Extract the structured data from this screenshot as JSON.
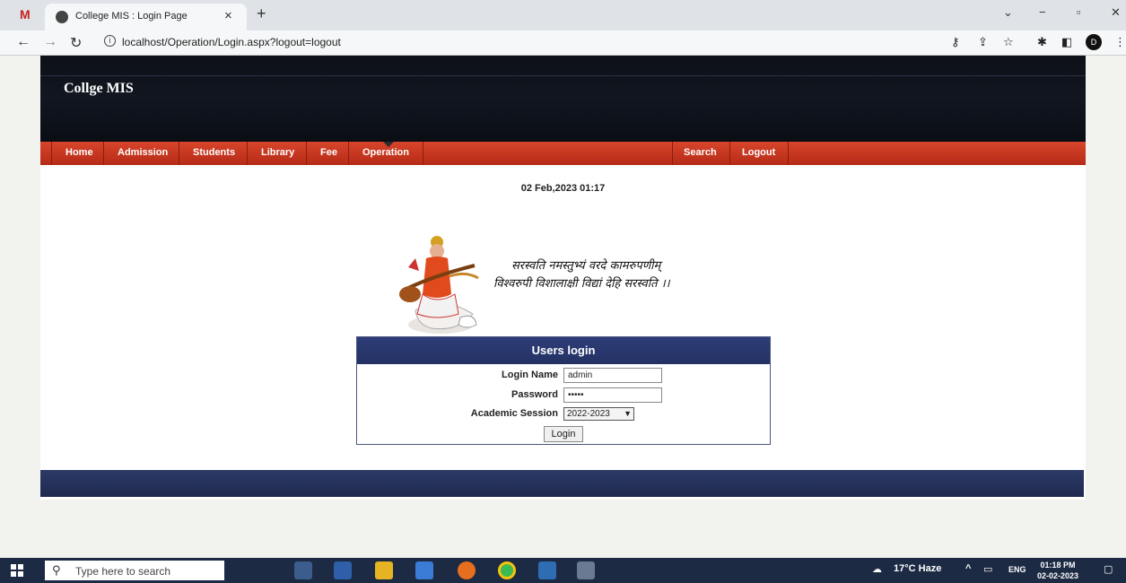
{
  "browser": {
    "tab_title": "College MIS : Login Page",
    "url": "localhost/Operation/Login.aspx?logout=logout"
  },
  "site": {
    "title": "Collge MIS",
    "menu_left": [
      "Home",
      "Admission",
      "Students",
      "Library",
      "Fee",
      "Operation"
    ],
    "menu_right": [
      "Search",
      "Logout"
    ],
    "datetime": "02 Feb,2023 01:17",
    "verse_line1": "सरस्वति नमस्तुभ्यं वरदे कामरुपणीम्",
    "verse_line2": "विश्वरुपी विशालाक्षी विद्यां देहि सरस्वति ।।"
  },
  "login": {
    "heading": "Users login",
    "name_label": "Login Name",
    "name_value": "admin",
    "password_label": "Password",
    "password_value": "•••••",
    "session_label": "Academic Session",
    "session_value": "2022-2023",
    "button_label": "Login"
  },
  "taskbar": {
    "search_placeholder": "Type here to search",
    "weather": "17°C Haze",
    "language": "ENG",
    "time": "01:18 PM",
    "date": "02-02-2023"
  }
}
